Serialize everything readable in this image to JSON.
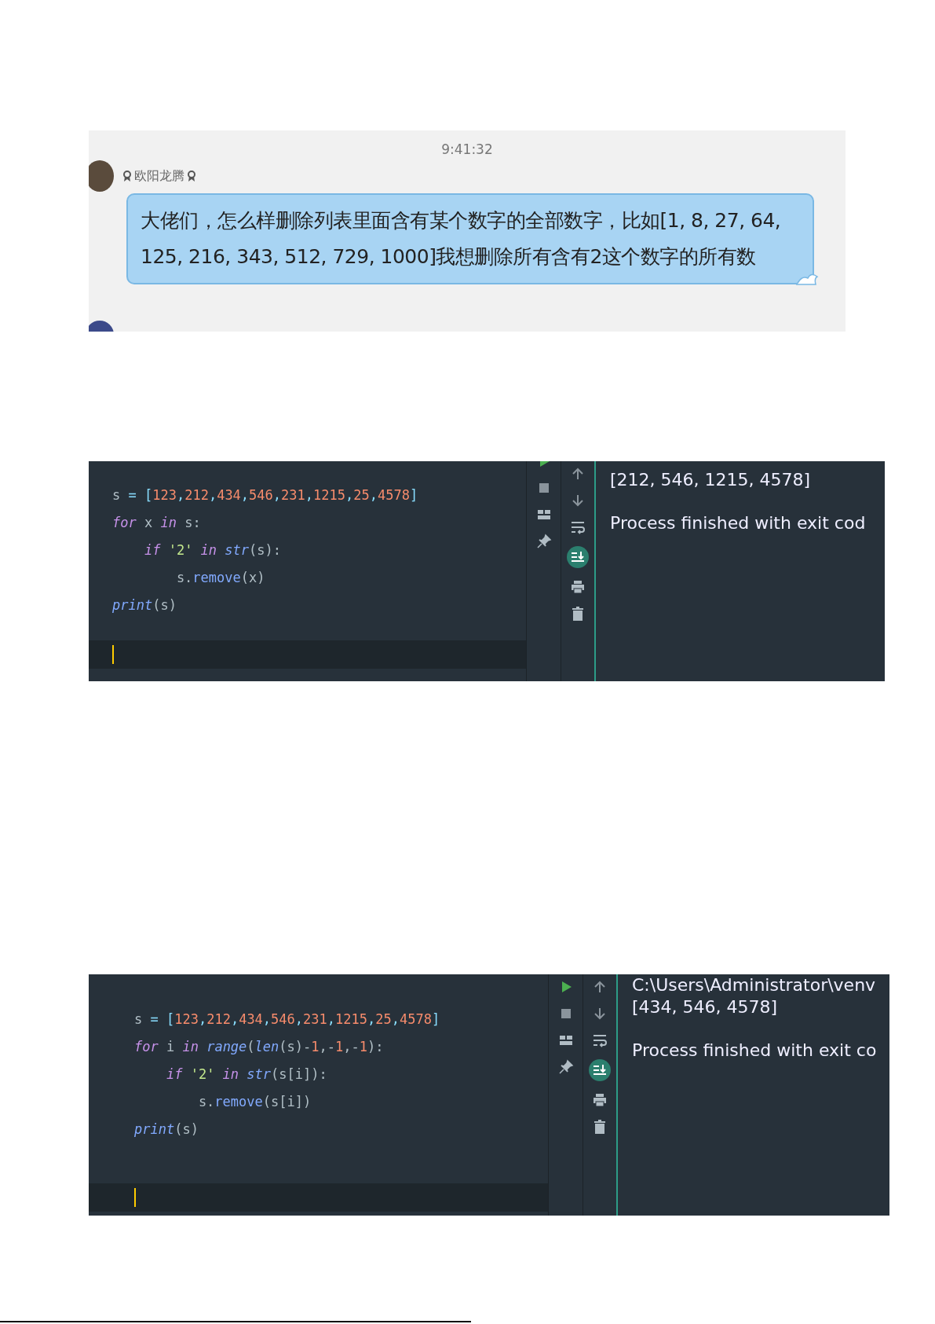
{
  "chat": {
    "time": "9:41:32",
    "sender": "欧阳龙腾",
    "message": "大佬们，怎么样删除列表里面含有某个数字的全部数字，比如[1, 8, 27, 64, 125, 216, 343, 512, 729, 1000]我想删除所有含有2这个数字的所有数"
  },
  "ide_panels": [
    {
      "code": [
        [
          {
            "text": "s ",
            "kind": "plain"
          },
          {
            "text": "= [",
            "kind": "op"
          },
          {
            "text": "123",
            "kind": "num"
          },
          {
            "text": ",",
            "kind": "op"
          },
          {
            "text": "212",
            "kind": "num"
          },
          {
            "text": ",",
            "kind": "op"
          },
          {
            "text": "434",
            "kind": "num"
          },
          {
            "text": ",",
            "kind": "op"
          },
          {
            "text": "546",
            "kind": "num"
          },
          {
            "text": ",",
            "kind": "op"
          },
          {
            "text": "231",
            "kind": "num"
          },
          {
            "text": ",",
            "kind": "op"
          },
          {
            "text": "1215",
            "kind": "num"
          },
          {
            "text": ",",
            "kind": "op"
          },
          {
            "text": "25",
            "kind": "num"
          },
          {
            "text": ",",
            "kind": "op"
          },
          {
            "text": "4578",
            "kind": "num"
          },
          {
            "text": "]",
            "kind": "op"
          }
        ],
        [
          {
            "text": "for",
            "kind": "kw"
          },
          {
            "text": " x ",
            "kind": "plain"
          },
          {
            "text": "in",
            "kind": "kw"
          },
          {
            "text": " s:",
            "kind": "plain"
          }
        ],
        [
          {
            "text": "    if",
            "kind": "kw"
          },
          {
            "text": " '2' ",
            "kind": "str"
          },
          {
            "text": "in",
            "kind": "kw"
          },
          {
            "text": " str",
            "kind": "builtin"
          },
          {
            "text": "(s):",
            "kind": "plain"
          }
        ],
        [
          {
            "text": "        s.",
            "kind": "plain"
          },
          {
            "text": "remove",
            "kind": "method"
          },
          {
            "text": "(x)",
            "kind": "plain"
          }
        ],
        [
          {
            "text": "print",
            "kind": "builtin"
          },
          {
            "text": "(s)",
            "kind": "plain"
          }
        ]
      ],
      "autoscroll_on": true,
      "output": [
        {
          "text": "[212, 546, 1215, 4578]",
          "kind": "result"
        },
        {
          "text": "Process finished with exit cod",
          "kind": "status"
        }
      ]
    },
    {
      "code": [
        [
          {
            "text": "s ",
            "kind": "plain"
          },
          {
            "text": "= [",
            "kind": "op"
          },
          {
            "text": "123",
            "kind": "num"
          },
          {
            "text": ",",
            "kind": "op"
          },
          {
            "text": "212",
            "kind": "num"
          },
          {
            "text": ",",
            "kind": "op"
          },
          {
            "text": "434",
            "kind": "num"
          },
          {
            "text": ",",
            "kind": "op"
          },
          {
            "text": "546",
            "kind": "num"
          },
          {
            "text": ",",
            "kind": "op"
          },
          {
            "text": "231",
            "kind": "num"
          },
          {
            "text": ",",
            "kind": "op"
          },
          {
            "text": "1215",
            "kind": "num"
          },
          {
            "text": ",",
            "kind": "op"
          },
          {
            "text": "25",
            "kind": "num"
          },
          {
            "text": ",",
            "kind": "op"
          },
          {
            "text": "4578",
            "kind": "num"
          },
          {
            "text": "]",
            "kind": "op"
          }
        ],
        [
          {
            "text": "for",
            "kind": "kw"
          },
          {
            "text": " i ",
            "kind": "plain"
          },
          {
            "text": "in",
            "kind": "kw"
          },
          {
            "text": " range",
            "kind": "builtin"
          },
          {
            "text": "(",
            "kind": "plain"
          },
          {
            "text": "len",
            "kind": "builtin"
          },
          {
            "text": "(s)-",
            "kind": "plain"
          },
          {
            "text": "1",
            "kind": "num"
          },
          {
            "text": ",-",
            "kind": "plain"
          },
          {
            "text": "1",
            "kind": "num"
          },
          {
            "text": ",-",
            "kind": "plain"
          },
          {
            "text": "1",
            "kind": "num"
          },
          {
            "text": "):",
            "kind": "plain"
          }
        ],
        [
          {
            "text": "    if",
            "kind": "kw"
          },
          {
            "text": " '2' ",
            "kind": "str"
          },
          {
            "text": "in",
            "kind": "kw"
          },
          {
            "text": " str",
            "kind": "builtin"
          },
          {
            "text": "(s[i]):",
            "kind": "plain"
          }
        ],
        [
          {
            "text": "        s.",
            "kind": "plain"
          },
          {
            "text": "remove",
            "kind": "method"
          },
          {
            "text": "(s[i])",
            "kind": "plain"
          }
        ],
        [
          {
            "text": "print",
            "kind": "builtin"
          },
          {
            "text": "(s)",
            "kind": "plain"
          }
        ]
      ],
      "autoscroll_on": true,
      "output": [
        {
          "text": "C:\\Users\\Administrator\\venv",
          "kind": "path"
        },
        {
          "text": "[434, 546, 4578]",
          "kind": "result"
        },
        {
          "text": "Process finished with exit co",
          "kind": "status"
        }
      ]
    }
  ]
}
